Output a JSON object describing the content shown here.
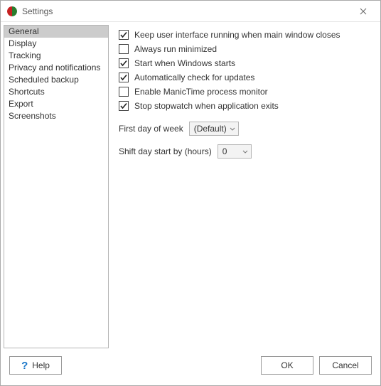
{
  "window": {
    "title": "Settings"
  },
  "sidebar": {
    "items": [
      {
        "label": "General",
        "selected": true
      },
      {
        "label": "Display",
        "selected": false
      },
      {
        "label": "Tracking",
        "selected": false
      },
      {
        "label": "Privacy and notifications",
        "selected": false
      },
      {
        "label": "Scheduled backup",
        "selected": false
      },
      {
        "label": "Shortcuts",
        "selected": false
      },
      {
        "label": "Export",
        "selected": false
      },
      {
        "label": "Screenshots",
        "selected": false
      }
    ]
  },
  "options": [
    {
      "label": "Keep user interface running when main window closes",
      "checked": true
    },
    {
      "label": "Always run minimized",
      "checked": false
    },
    {
      "label": "Start when Windows starts",
      "checked": true
    },
    {
      "label": "Automatically check for updates",
      "checked": true
    },
    {
      "label": "Enable ManicTime process monitor",
      "checked": false
    },
    {
      "label": "Stop stopwatch when application exits",
      "checked": true
    }
  ],
  "firstDay": {
    "label": "First day of week",
    "value": "(Default)"
  },
  "shiftDay": {
    "label": "Shift day start by (hours)",
    "value": "0"
  },
  "buttons": {
    "help": "Help",
    "ok": "OK",
    "cancel": "Cancel"
  }
}
